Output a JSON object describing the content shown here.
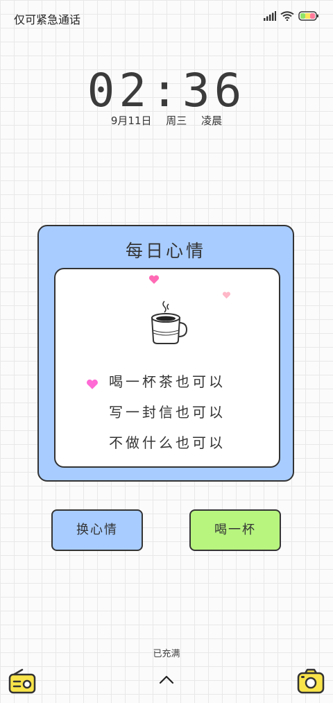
{
  "status": {
    "carrier_text": "仅可紧急通话",
    "icons": [
      "signal-icon",
      "wifi-icon",
      "battery-icon"
    ]
  },
  "lockscreen": {
    "time": "02:36",
    "date": "9月11日",
    "weekday": "周三",
    "period": "凌晨"
  },
  "card": {
    "title": "每日心情",
    "lines": [
      "喝一杯茶也可以",
      "写一封信也可以",
      "不做什么也可以"
    ]
  },
  "buttons": {
    "change_mood": "换心情",
    "have_a_drink": "喝一杯"
  },
  "charging_text": "已充满",
  "colors": {
    "card_blue": "#a8ccff",
    "button_green": "#b7f57f",
    "heart_pink": "#ff6ab5",
    "shortcut_yellow": "#f9e44a"
  }
}
